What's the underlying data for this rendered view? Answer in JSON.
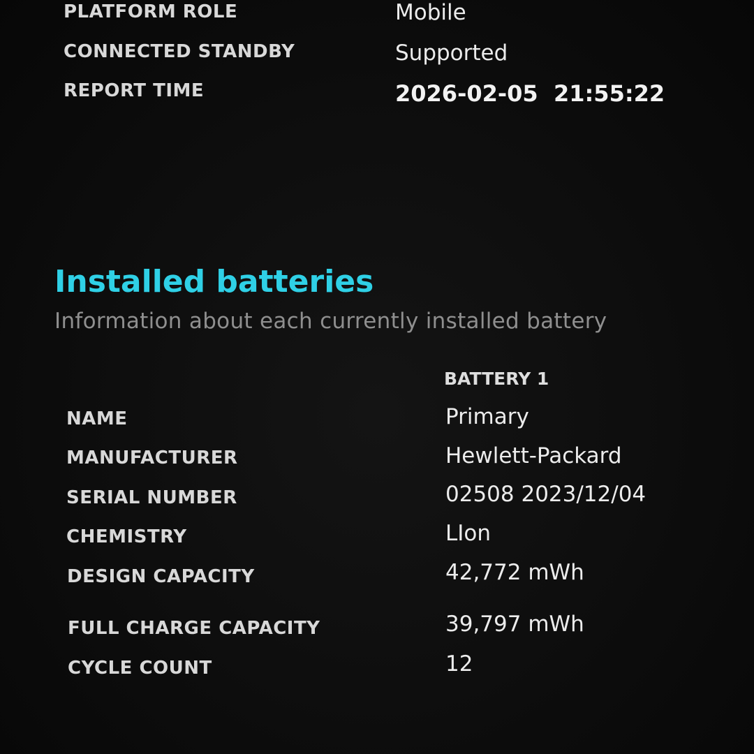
{
  "system_info": {
    "platform_role": {
      "label": "PLATFORM ROLE",
      "value": "Mobile"
    },
    "connected_standby": {
      "label": "CONNECTED STANDBY",
      "value": "Supported"
    },
    "report_time": {
      "label": "REPORT TIME",
      "value": "2026-02-05  21:55:22"
    }
  },
  "installed_batteries": {
    "title": "Installed batteries",
    "subtitle": "Information about each currently installed battery",
    "column_header": "BATTERY 1",
    "rows": [
      {
        "label": "NAME",
        "value": "Primary"
      },
      {
        "label": "MANUFACTURER",
        "value": "Hewlett-Packard"
      },
      {
        "label": "SERIAL NUMBER",
        "value": "02508 2023/12/04"
      },
      {
        "label": "CHEMISTRY",
        "value": "LIon"
      },
      {
        "label": "DESIGN CAPACITY",
        "value": "42,772 mWh"
      },
      {
        "label": "FULL CHARGE CAPACITY",
        "value": "39,797 mWh"
      },
      {
        "label": "CYCLE COUNT",
        "value": "12"
      }
    ]
  },
  "colors": {
    "background": "#0b0b0b",
    "accent_title": "#2fd0e6",
    "subtitle": "#8f8f8f",
    "text": "#e6e6e6"
  }
}
